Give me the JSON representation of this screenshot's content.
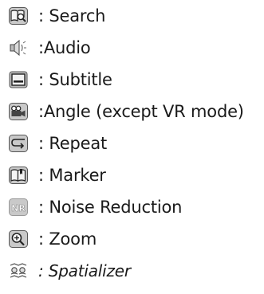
{
  "legend": {
    "items": [
      {
        "icon": "search-icon",
        "label": ": Search"
      },
      {
        "icon": "audio-icon",
        "label": ":Audio"
      },
      {
        "icon": "subtitle-icon",
        "label": ": Subtitle"
      },
      {
        "icon": "angle-icon",
        "label": ":Angle (except VR mode)"
      },
      {
        "icon": "repeat-icon",
        "label": ": Repeat"
      },
      {
        "icon": "marker-icon",
        "label": ": Marker"
      },
      {
        "icon": "noise-reduction-icon",
        "label": ": Noise Reduction",
        "icon_text": "NR"
      },
      {
        "icon": "zoom-icon",
        "label": ": Zoom"
      },
      {
        "icon": "spatializer-icon",
        "label": ": Spatializer"
      }
    ]
  }
}
